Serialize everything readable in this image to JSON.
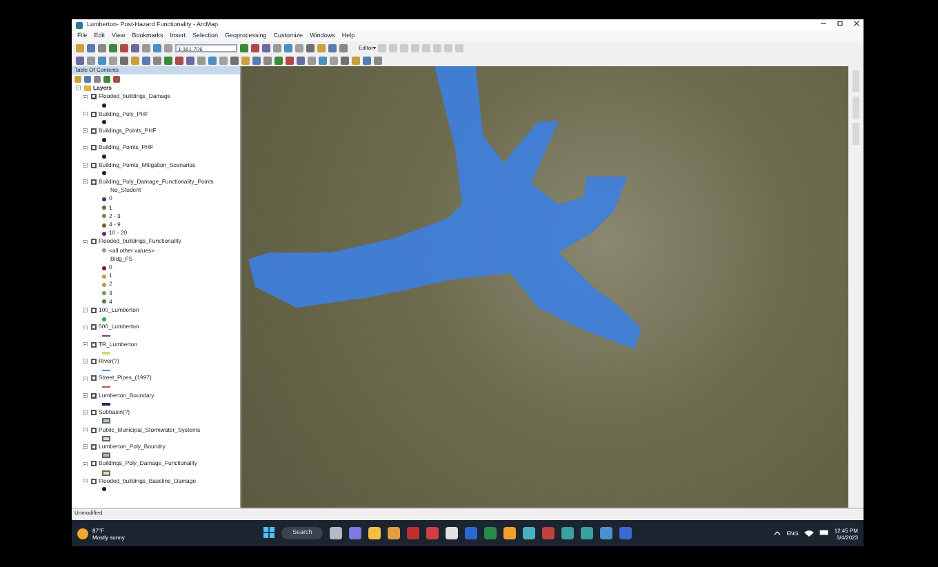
{
  "window": {
    "title": "Lumberton- Post-Hazard Functionality - ArcMap"
  },
  "menu": [
    "File",
    "Edit",
    "View",
    "Bookmarks",
    "Insert",
    "Selection",
    "Geoprocessing",
    "Customize",
    "Windows",
    "Help"
  ],
  "toolbar": {
    "scale": "1:161,706",
    "editor": "Editor▾"
  },
  "toc": {
    "title": "Table Of Contents",
    "root": "Layers",
    "layers": [
      {
        "name": "Flooded_buildings_Damage",
        "checked": true,
        "symbol": {
          "kind": "dot",
          "color": "#222222"
        }
      },
      {
        "name": "Building_Poly_PHF",
        "checked": false,
        "symbol": {
          "kind": "dot",
          "color": "#222222"
        }
      },
      {
        "name": "Buildings_Points_PHF",
        "checked": false,
        "symbol": {
          "kind": "dot",
          "color": "#222222"
        }
      },
      {
        "name": "Building_Points_PHF",
        "checked": false,
        "symbol": {
          "kind": "dot",
          "color": "#222222"
        }
      },
      {
        "name": "Building_Points_Mitigation_Scenarios",
        "checked": false,
        "symbol": {
          "kind": "dot",
          "color": "#222222"
        }
      },
      {
        "name": "Building_Poly_Damage_Functionality_Points",
        "checked": false,
        "field": "No_Student",
        "classes": [
          {
            "label": "0",
            "color": "#3a3a7a"
          },
          {
            "label": "1",
            "color": "#4a7a3a"
          },
          {
            "label": "2 - 3",
            "color": "#7a8a3a"
          },
          {
            "label": "4 - 9",
            "color": "#8a5a2a"
          },
          {
            "label": "10 - 20",
            "color": "#7a2a5a"
          }
        ]
      },
      {
        "name": "Flooded_buildings_Functionality",
        "checked": false,
        "field": "Bldg_FS",
        "other": "<all other values>",
        "classes": [
          {
            "label": "0",
            "color": "#8a1a1a"
          },
          {
            "label": "1",
            "color": "#c8a030"
          },
          {
            "label": "2",
            "color": "#a0a060"
          },
          {
            "label": "3",
            "color": "#7a9a5a"
          },
          {
            "label": "4",
            "color": "#5a7a4a"
          }
        ]
      },
      {
        "name": "100_Lumberton",
        "checked": false,
        "symbol": {
          "kind": "dot",
          "color": "#2fa84a"
        }
      },
      {
        "name": "500_Lumberton",
        "checked": false,
        "symbol": {
          "kind": "line",
          "color": "#9a2a8a"
        }
      },
      {
        "name": "TR_Lumberton",
        "checked": false,
        "symbol": {
          "kind": "line",
          "color": "#c8e070"
        }
      },
      {
        "name": "River(?)",
        "checked": false,
        "symbol": {
          "kind": "line",
          "color": "#4a9ad0"
        }
      },
      {
        "name": "Street_Pipes_(1997)",
        "checked": false,
        "symbol": {
          "kind": "line",
          "color": "#c05050"
        }
      },
      {
        "name": "Lumberton_Boundary",
        "checked": true,
        "symbol": {
          "kind": "line",
          "color": "#1a2a5a"
        }
      },
      {
        "name": "Subbasin(?)",
        "checked": false,
        "symbol": {
          "kind": "fill",
          "color": "#a8d0b0"
        }
      },
      {
        "name": "Public_Municipal_Stormwater_Systems",
        "checked": false,
        "symbol": {
          "kind": "fill",
          "color": "#e8e0c0"
        }
      },
      {
        "name": "Lumberton_Poly_Boundry",
        "checked": false,
        "symbol": {
          "kind": "fill",
          "color": "#b0b0d8"
        }
      },
      {
        "name": "Buildings_Poly_Damage_Functionality",
        "checked": false,
        "symbol": {
          "kind": "fill",
          "color": "#e0e0b0"
        }
      },
      {
        "name": "Flooded_buildings_Baseline_Damage",
        "checked": false,
        "symbol": {
          "kind": "dot",
          "color": "#222222"
        }
      }
    ]
  },
  "status_bar": "Unmodified",
  "taskbar": {
    "temperature": "87°F",
    "weather": "Mostly sunny",
    "search": "Search",
    "language": "ENG",
    "time": "12:45 PM",
    "date": "3/4/2023"
  }
}
